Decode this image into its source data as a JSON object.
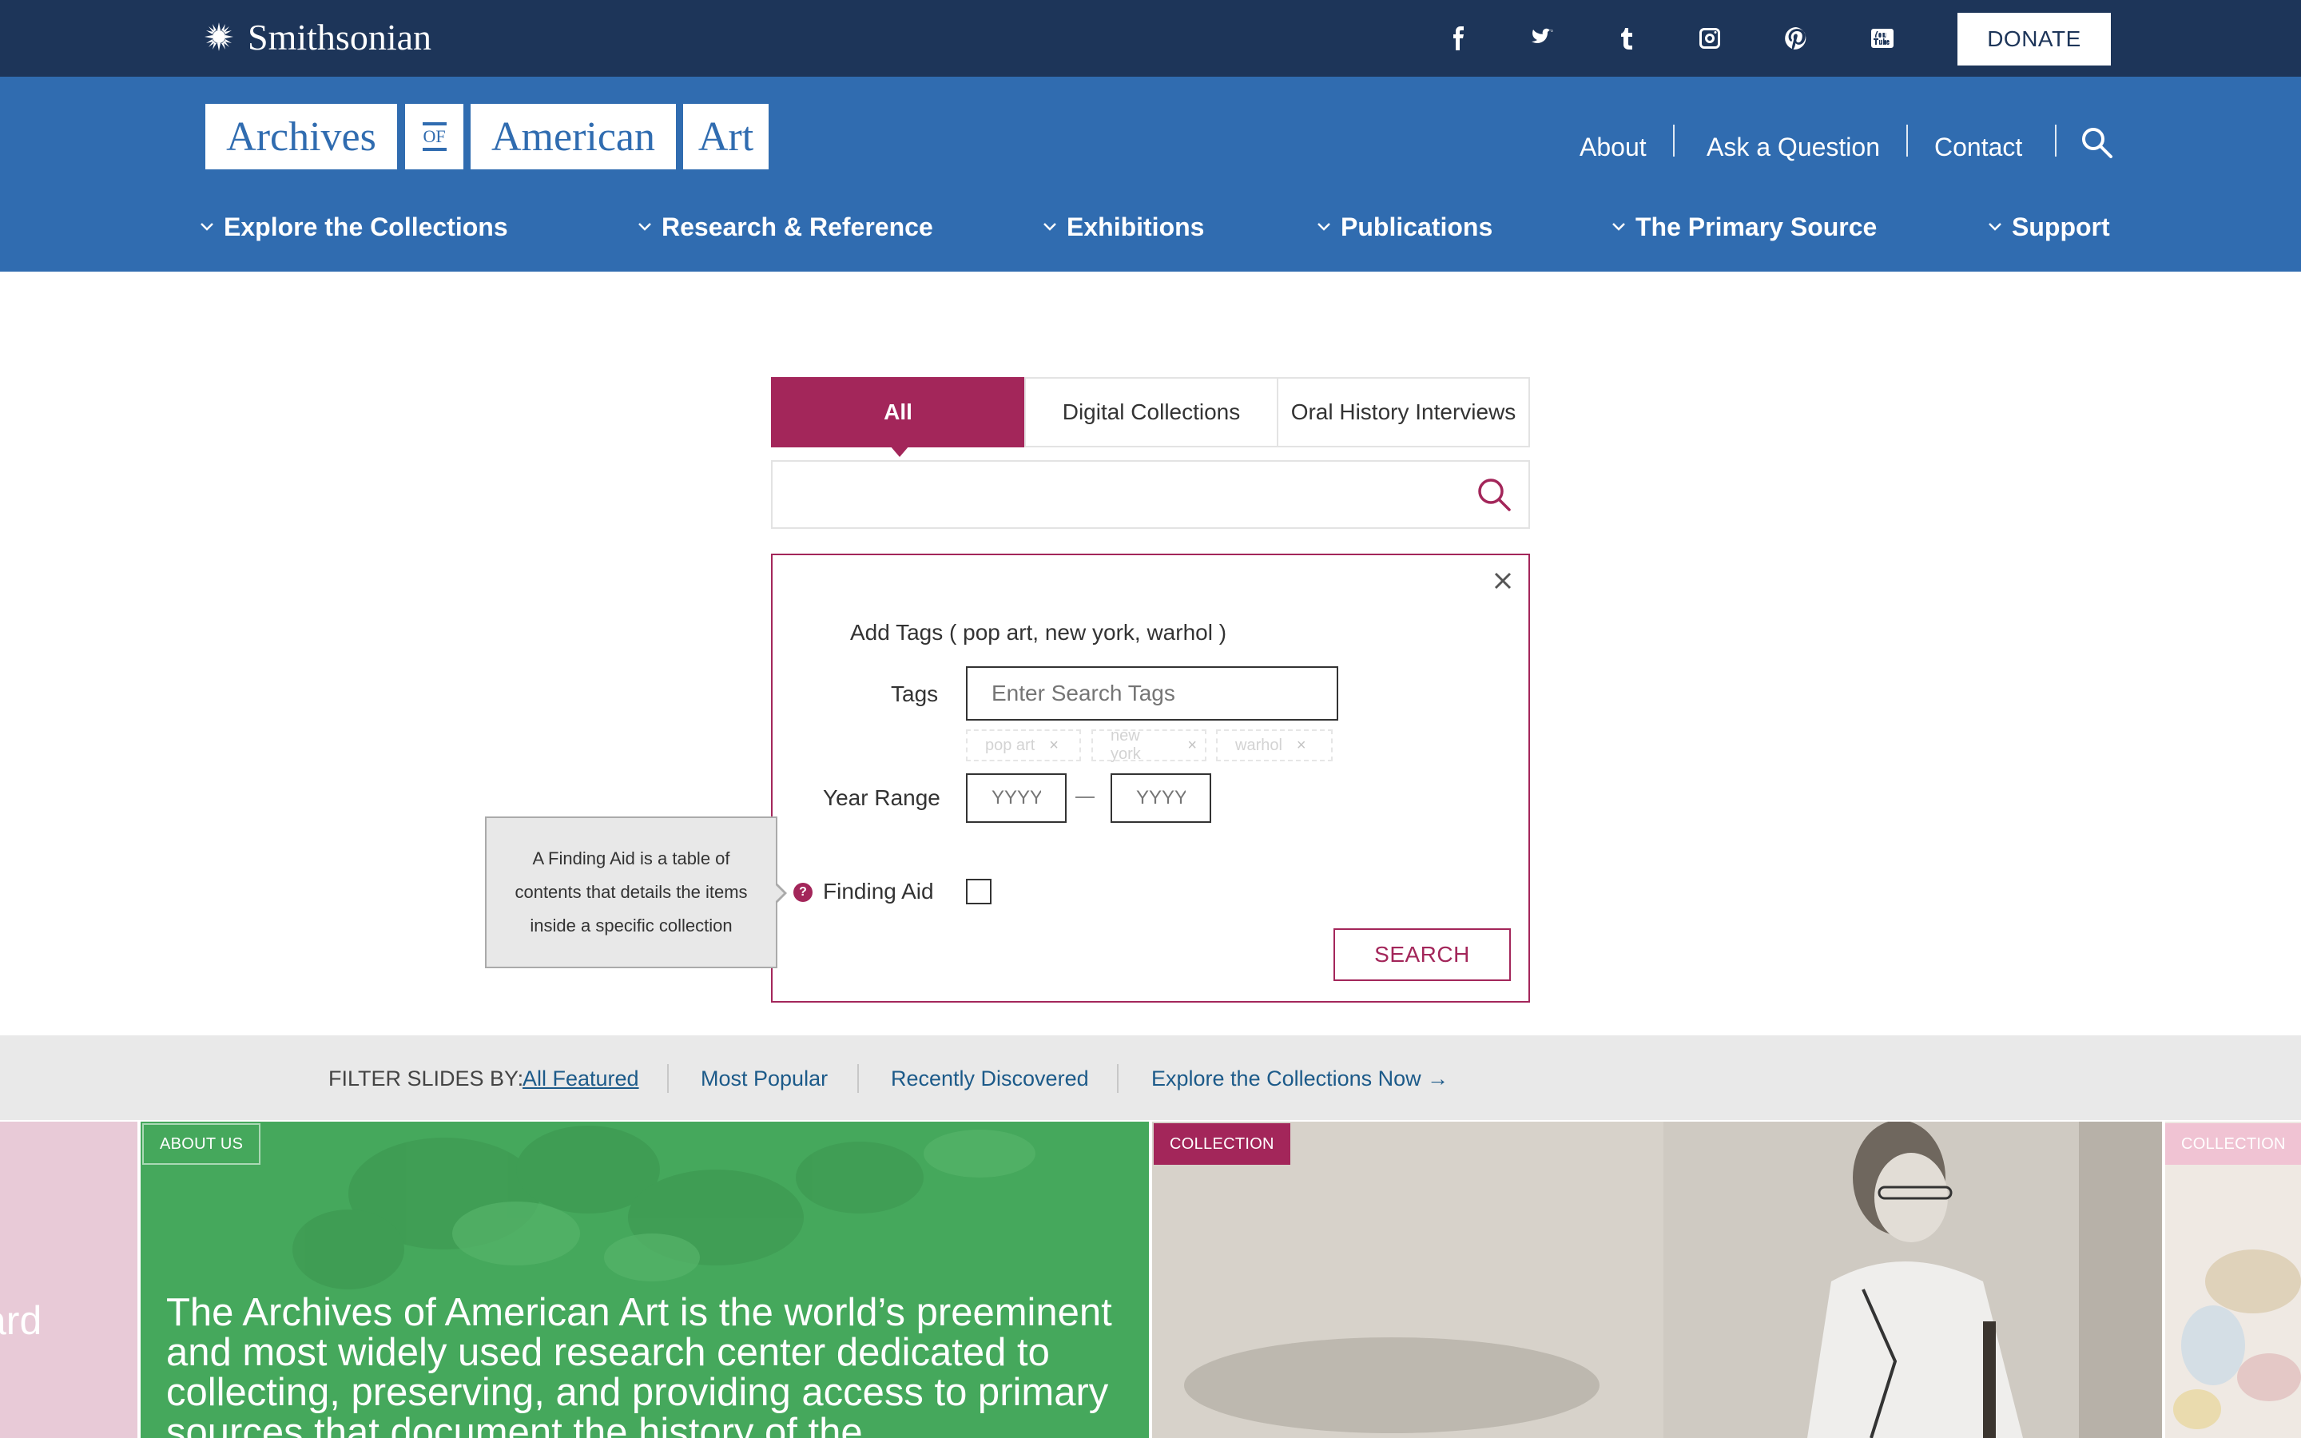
{
  "topbar": {
    "logo": "Smithsonian",
    "social": [
      "facebook-icon",
      "twitter-icon",
      "tumblr-icon",
      "instagram-icon",
      "pinterest-icon",
      "youtube-icon"
    ],
    "donate": "DONATE"
  },
  "header": {
    "logo_parts": [
      "Archives",
      "OF",
      "American",
      "Art"
    ],
    "utility": [
      "About",
      "Ask a Question",
      "Contact"
    ],
    "nav": [
      "Explore the Collections",
      "Research & Reference",
      "Exhibitions",
      "Publications",
      "The Primary Source",
      "Support"
    ]
  },
  "search": {
    "tabs": [
      "All",
      "Digital Collections",
      "Oral History Interviews"
    ],
    "active_tab": "All",
    "query": ""
  },
  "advanced": {
    "heading": "Add Tags ( pop art, new york, warhol )",
    "tags_label": "Tags",
    "tags_placeholder": "Enter Search Tags",
    "tag_chips": [
      "pop art",
      "new york",
      "warhol"
    ],
    "year_label": "Year Range",
    "year_from_placeholder": "YYYY",
    "year_to_placeholder": "YYYY",
    "finding_aid_label": "Finding Aid",
    "finding_aid_checked": false,
    "help_icon": "?",
    "search_button": "SEARCH",
    "tooltip": [
      "A Finding Aid is a table of",
      "contents that details the items",
      "inside a specific collection"
    ]
  },
  "filter": {
    "label": "FILTER SLIDES BY:",
    "options": [
      "All Featured",
      "Most Popular",
      "Recently Discovered"
    ],
    "active": "All Featured",
    "explore_link": "Explore the Collections Now →"
  },
  "slides": {
    "left_fragment": "ard",
    "about_badge": "ABOUT US",
    "about_headline": "The Archives of American Art is the world’s preeminent and most widely used research center dedicated to collecting, preserving, and providing access to primary sources that document the history of the",
    "collection_badge": "COLLECTION",
    "collection_badge_2": "COLLECTION"
  },
  "colors": {
    "smithsonian_navy": "#1d3559",
    "aaa_blue": "#306cb0",
    "accent_crimson": "#a3265a",
    "slide_green": "#45a85c",
    "link_blue": "#1c5a89"
  }
}
